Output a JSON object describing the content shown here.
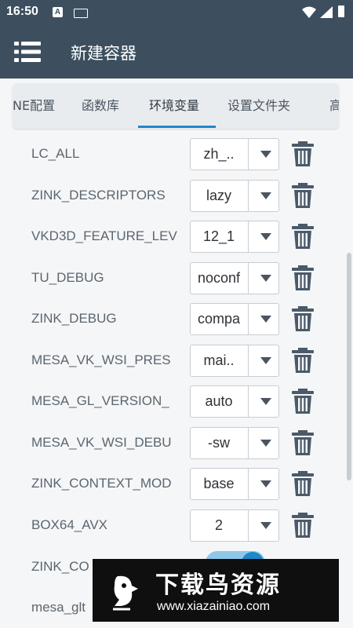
{
  "status": {
    "time": "16:50",
    "notif_a": "A"
  },
  "appbar": {
    "title": "新建容器"
  },
  "tabs": [
    "NE配置",
    "函数库",
    "环境变量",
    "设置文件夹",
    "高"
  ],
  "active_tab": "环境变量",
  "env": [
    {
      "name": "LC_ALL",
      "value": "zh_.."
    },
    {
      "name": "ZINK_DESCRIPTORS",
      "value": "lazy"
    },
    {
      "name": "VKD3D_FEATURE_LEV",
      "value": "12_1"
    },
    {
      "name": "TU_DEBUG",
      "value": "noconf"
    },
    {
      "name": "ZINK_DEBUG",
      "value": "compa"
    },
    {
      "name": "MESA_VK_WSI_PRES",
      "value": "mai.."
    },
    {
      "name": "MESA_GL_VERSION_",
      "value": "auto"
    },
    {
      "name": "MESA_VK_WSI_DEBU",
      "value": "-sw"
    },
    {
      "name": "ZINK_CONTEXT_MOD",
      "value": "base"
    },
    {
      "name": "BOX64_AVX",
      "value": "2"
    }
  ],
  "partial_rows": [
    {
      "name": "ZINK_CO",
      "toggle_on": true
    },
    {
      "name": "mesa_glt"
    }
  ],
  "watermark": {
    "brand": "下载鸟资源",
    "url": "www.xiazainiao.com"
  },
  "colors": {
    "appbar": "#3d4f5f",
    "accent": "#1e88c9",
    "toggle_track": "#8cc8ea",
    "icon": "#4a5a6a"
  }
}
